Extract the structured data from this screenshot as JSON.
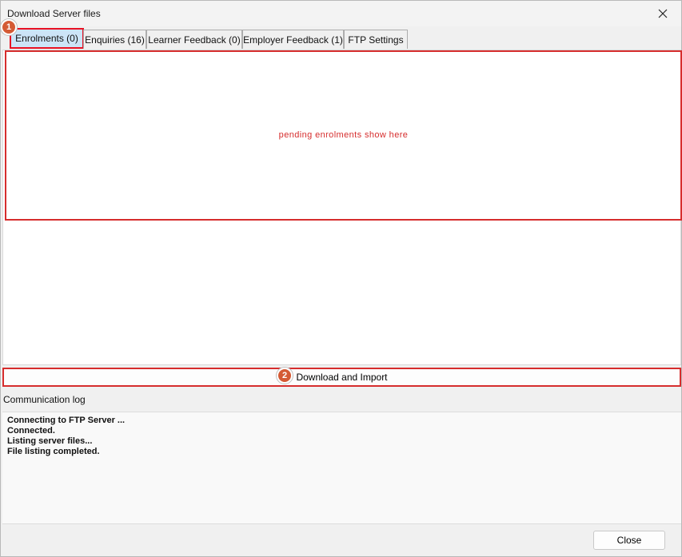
{
  "window": {
    "title": "Download Server files"
  },
  "tabs": [
    {
      "label": "Enrolments (0)",
      "active": true
    },
    {
      "label": "Enquiries (16)",
      "active": false
    },
    {
      "label": "Learner Feedback (0)",
      "active": false
    },
    {
      "label": "Employer Feedback (1)",
      "active": false
    },
    {
      "label": "FTP Settings",
      "active": false
    }
  ],
  "pending": {
    "text": "pending enrolments show here"
  },
  "markers": {
    "one": "1",
    "two": "2"
  },
  "download_button": {
    "label": "Download and Import"
  },
  "log": {
    "label": "Communication log",
    "lines": [
      "Connecting to FTP Server ...",
      "Connected.",
      "Listing server files...",
      "File listing completed."
    ]
  },
  "close_button": {
    "label": "Close"
  },
  "colors": {
    "highlight": "#d62d2d",
    "marker": "#d45a34",
    "active_tab": "#cce4f7"
  },
  "icons": {
    "close": "close-icon"
  }
}
